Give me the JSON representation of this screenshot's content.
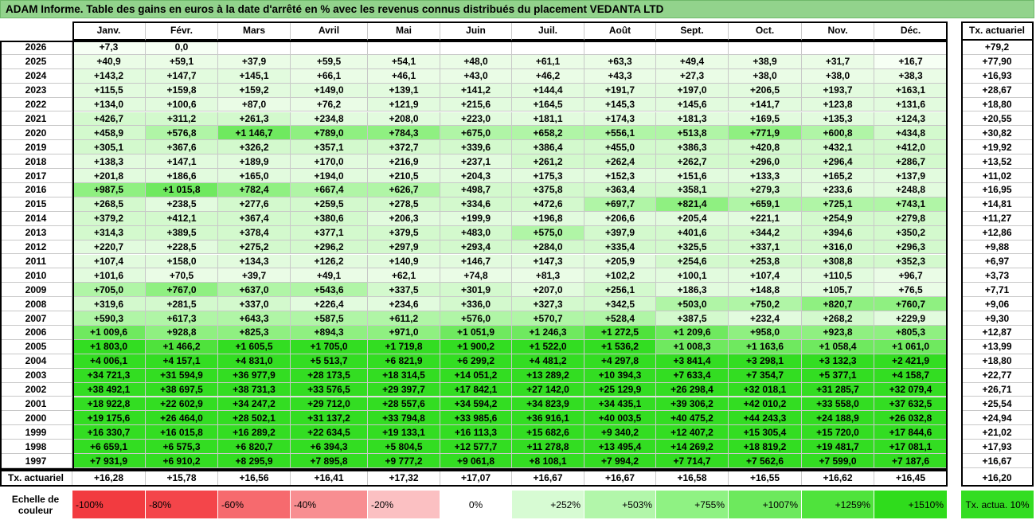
{
  "title": "ADAM Informe. Table des gains en euros à la date d'arrêté en % avec les revenus connus distribués du placement VEDANTA LTD",
  "chart_data": {
    "type": "table",
    "columns": [
      "Janv.",
      "Févr.",
      "Mars",
      "Avril",
      "Mai",
      "Juin",
      "Juil.",
      "Août",
      "Sept.",
      "Oct.",
      "Nov.",
      "Déc."
    ],
    "rate_header": "Tx. actuariel",
    "rows": [
      {
        "year": "2026",
        "values": [
          "+7,3",
          "0,0",
          "",
          "",
          "",
          "",
          "",
          "",
          "",
          "",
          "",
          ""
        ],
        "rate": "+79,2"
      },
      {
        "year": "2025",
        "values": [
          "+40,9",
          "+59,1",
          "+37,9",
          "+59,5",
          "+54,1",
          "+48,0",
          "+61,1",
          "+63,3",
          "+49,4",
          "+38,9",
          "+31,7",
          "+16,7"
        ],
        "rate": "+77,90"
      },
      {
        "year": "2024",
        "values": [
          "+143,2",
          "+147,7",
          "+145,1",
          "+66,1",
          "+46,1",
          "+43,0",
          "+46,2",
          "+43,3",
          "+27,3",
          "+38,0",
          "+38,0",
          "+38,3"
        ],
        "rate": "+16,93"
      },
      {
        "year": "2023",
        "values": [
          "+115,5",
          "+159,8",
          "+159,2",
          "+149,0",
          "+139,1",
          "+141,2",
          "+144,4",
          "+191,7",
          "+197,0",
          "+206,5",
          "+193,7",
          "+163,1"
        ],
        "rate": "+28,67"
      },
      {
        "year": "2022",
        "values": [
          "+134,0",
          "+100,6",
          "+87,0",
          "+76,2",
          "+121,9",
          "+215,6",
          "+164,5",
          "+145,3",
          "+145,6",
          "+141,7",
          "+123,8",
          "+131,6"
        ],
        "rate": "+18,80"
      },
      {
        "year": "2021",
        "values": [
          "+426,7",
          "+311,2",
          "+261,3",
          "+234,8",
          "+208,0",
          "+223,0",
          "+181,1",
          "+174,3",
          "+181,3",
          "+169,5",
          "+135,3",
          "+124,3"
        ],
        "rate": "+20,55"
      },
      {
        "year": "2020",
        "values": [
          "+458,9",
          "+576,8",
          "+1 146,7",
          "+789,0",
          "+784,3",
          "+675,0",
          "+658,2",
          "+556,1",
          "+513,8",
          "+771,9",
          "+600,8",
          "+434,8"
        ],
        "rate": "+30,82"
      },
      {
        "year": "2019",
        "values": [
          "+305,1",
          "+367,6",
          "+326,2",
          "+357,1",
          "+372,7",
          "+339,6",
          "+386,4",
          "+455,0",
          "+386,3",
          "+420,8",
          "+432,1",
          "+412,0"
        ],
        "rate": "+19,92"
      },
      {
        "year": "2018",
        "values": [
          "+138,3",
          "+147,1",
          "+189,9",
          "+170,0",
          "+216,9",
          "+237,1",
          "+261,2",
          "+262,4",
          "+262,7",
          "+296,0",
          "+296,4",
          "+286,7"
        ],
        "rate": "+13,52"
      },
      {
        "year": "2017",
        "values": [
          "+201,8",
          "+186,6",
          "+165,0",
          "+194,0",
          "+210,5",
          "+204,3",
          "+175,3",
          "+152,3",
          "+151,6",
          "+133,3",
          "+165,2",
          "+137,9"
        ],
        "rate": "+11,02"
      },
      {
        "year": "2016",
        "values": [
          "+987,5",
          "+1 015,8",
          "+782,4",
          "+667,4",
          "+626,7",
          "+498,7",
          "+375,8",
          "+363,4",
          "+358,1",
          "+279,3",
          "+233,6",
          "+248,8"
        ],
        "rate": "+16,95"
      },
      {
        "year": "2015",
        "values": [
          "+268,5",
          "+238,5",
          "+277,6",
          "+259,5",
          "+278,5",
          "+334,6",
          "+472,6",
          "+697,7",
          "+821,4",
          "+659,1",
          "+725,1",
          "+743,1"
        ],
        "rate": "+14,81"
      },
      {
        "year": "2014",
        "values": [
          "+379,2",
          "+412,1",
          "+367,4",
          "+380,6",
          "+206,3",
          "+199,9",
          "+196,8",
          "+206,6",
          "+205,4",
          "+221,1",
          "+254,9",
          "+279,8"
        ],
        "rate": "+11,27"
      },
      {
        "year": "2013",
        "values": [
          "+314,3",
          "+389,5",
          "+378,4",
          "+377,1",
          "+379,5",
          "+483,0",
          "+575,0",
          "+397,9",
          "+401,6",
          "+344,2",
          "+394,6",
          "+350,2"
        ],
        "rate": "+12,86"
      },
      {
        "year": "2012",
        "values": [
          "+220,7",
          "+228,5",
          "+275,2",
          "+296,2",
          "+297,9",
          "+293,4",
          "+284,0",
          "+335,4",
          "+325,5",
          "+337,1",
          "+316,0",
          "+296,3"
        ],
        "rate": "+9,88"
      },
      {
        "year": "2011",
        "values": [
          "+107,4",
          "+158,0",
          "+134,3",
          "+126,2",
          "+140,9",
          "+146,7",
          "+147,3",
          "+205,9",
          "+254,6",
          "+253,8",
          "+308,8",
          "+352,3"
        ],
        "rate": "+6,97"
      },
      {
        "year": "2010",
        "values": [
          "+101,6",
          "+70,5",
          "+39,7",
          "+49,1",
          "+62,1",
          "+74,8",
          "+81,3",
          "+102,2",
          "+100,1",
          "+107,4",
          "+110,5",
          "+96,7"
        ],
        "rate": "+3,73"
      },
      {
        "year": "2009",
        "values": [
          "+705,0",
          "+767,0",
          "+637,0",
          "+543,6",
          "+337,5",
          "+301,9",
          "+207,0",
          "+256,1",
          "+186,3",
          "+148,8",
          "+105,7",
          "+76,5"
        ],
        "rate": "+7,71"
      },
      {
        "year": "2008",
        "values": [
          "+319,6",
          "+281,5",
          "+337,0",
          "+226,4",
          "+234,6",
          "+336,0",
          "+327,3",
          "+342,5",
          "+503,0",
          "+750,2",
          "+820,7",
          "+760,7"
        ],
        "rate": "+9,06"
      },
      {
        "year": "2007",
        "values": [
          "+590,3",
          "+617,3",
          "+643,3",
          "+587,5",
          "+611,2",
          "+576,0",
          "+570,7",
          "+528,4",
          "+387,5",
          "+232,4",
          "+268,2",
          "+229,9"
        ],
        "rate": "+9,30"
      },
      {
        "year": "2006",
        "values": [
          "+1 009,6",
          "+928,8",
          "+825,3",
          "+894,3",
          "+971,0",
          "+1 051,9",
          "+1 246,3",
          "+1 272,5",
          "+1 209,6",
          "+958,0",
          "+923,8",
          "+805,3"
        ],
        "rate": "+12,87"
      },
      {
        "year": "2005",
        "values": [
          "+1 803,0",
          "+1 466,2",
          "+1 605,5",
          "+1 705,0",
          "+1 719,8",
          "+1 900,2",
          "+1 522,0",
          "+1 536,2",
          "+1 008,3",
          "+1 163,6",
          "+1 058,4",
          "+1 061,0"
        ],
        "rate": "+13,99"
      },
      {
        "year": "2004",
        "values": [
          "+4 006,1",
          "+4 157,1",
          "+4 831,0",
          "+5 513,7",
          "+6 821,9",
          "+6 299,2",
          "+4 481,2",
          "+4 297,8",
          "+3 841,4",
          "+3 298,1",
          "+3 132,3",
          "+2 421,9"
        ],
        "rate": "+18,80"
      },
      {
        "year": "2003",
        "values": [
          "+34 721,3",
          "+31 594,9",
          "+36 977,9",
          "+28 173,5",
          "+18 314,5",
          "+14 051,2",
          "+13 289,2",
          "+10 394,3",
          "+7 633,4",
          "+7 354,7",
          "+5 377,1",
          "+4 158,7"
        ],
        "rate": "+22,77"
      },
      {
        "year": "2002",
        "values": [
          "+38 492,1",
          "+38 697,5",
          "+38 731,3",
          "+33 576,5",
          "+29 397,7",
          "+17 842,1",
          "+27 142,0",
          "+25 129,9",
          "+26 298,4",
          "+32 018,1",
          "+31 285,7",
          "+32 079,4"
        ],
        "rate": "+26,71"
      },
      {
        "year": "2001",
        "values": [
          "+18 922,8",
          "+22 602,9",
          "+34 247,2",
          "+29 712,0",
          "+28 557,6",
          "+34 594,2",
          "+34 823,9",
          "+34 435,1",
          "+39 306,2",
          "+42 010,2",
          "+33 558,0",
          "+37 632,5"
        ],
        "rate": "+25,54"
      },
      {
        "year": "2000",
        "values": [
          "+19 175,6",
          "+26 464,0",
          "+28 502,1",
          "+31 137,2",
          "+33 794,8",
          "+33 985,6",
          "+36 916,1",
          "+40 003,5",
          "+40 475,2",
          "+44 243,3",
          "+24 188,9",
          "+26 032,8"
        ],
        "rate": "+24,94"
      },
      {
        "year": "1999",
        "values": [
          "+16 330,7",
          "+16 015,8",
          "+16 289,2",
          "+22 634,5",
          "+19 133,1",
          "+16 113,3",
          "+15 682,6",
          "+9 340,2",
          "+12 407,2",
          "+15 305,4",
          "+15 720,0",
          "+17 844,6"
        ],
        "rate": "+21,02"
      },
      {
        "year": "1998",
        "values": [
          "+6 659,1",
          "+6 575,3",
          "+6 820,7",
          "+6 394,3",
          "+5 804,5",
          "+12 577,7",
          "+11 278,8",
          "+13 495,4",
          "+14 269,2",
          "+18 819,2",
          "+19 481,7",
          "+17 081,1"
        ],
        "rate": "+17,93"
      },
      {
        "year": "1997",
        "values": [
          "+7 931,9",
          "+6 910,2",
          "+8 295,9",
          "+7 895,8",
          "+9 777,2",
          "+9 061,8",
          "+8 108,1",
          "+7 994,2",
          "+7 714,7",
          "+7 562,6",
          "+7 599,0",
          "+7 187,6"
        ],
        "rate": "+16,67"
      }
    ],
    "footer": {
      "label": "Tx. actuariel",
      "values": [
        "+16,28",
        "+15,78",
        "+16,56",
        "+16,41",
        "+17,32",
        "+17,07",
        "+16,67",
        "+16,67",
        "+16,58",
        "+16,55",
        "+16,62",
        "+16,45"
      ],
      "rate": "+16,20"
    }
  },
  "scale": {
    "label": "Echelle de couleur",
    "items": [
      {
        "text": "-100%",
        "color": "#f23b40",
        "align": "left"
      },
      {
        "text": "-80%",
        "color": "#f4454a",
        "align": "left"
      },
      {
        "text": "-60%",
        "color": "#f66a6e",
        "align": "left"
      },
      {
        "text": "-40%",
        "color": "#f88e91",
        "align": "left"
      },
      {
        "text": "-20%",
        "color": "#fbc0c2",
        "align": "left"
      },
      {
        "text": "0%",
        "color": "#ffffff",
        "align": "center"
      },
      {
        "text": "+252%",
        "color": "#d7fbd3",
        "align": "right"
      },
      {
        "text": "+503%",
        "color": "#b2f6aa",
        "align": "right"
      },
      {
        "text": "+755%",
        "color": "#8ff283",
        "align": "right"
      },
      {
        "text": "+1007%",
        "color": "#6de95d",
        "align": "right"
      },
      {
        "text": "+1259%",
        "color": "#4fe33c",
        "align": "right"
      },
      {
        "text": "+1510%",
        "color": "#2fdc1c",
        "align": "right"
      }
    ],
    "rate_label": "Tx. actua. 10%",
    "rate_color": "#33dd22"
  }
}
